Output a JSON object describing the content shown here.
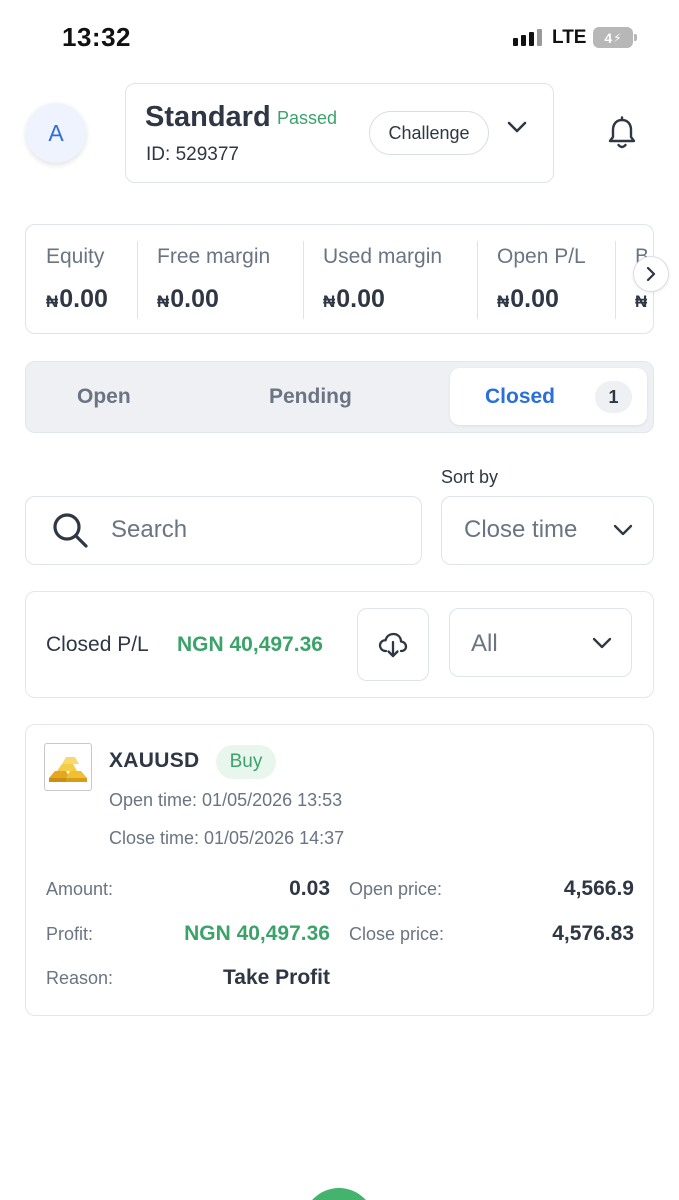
{
  "status_bar": {
    "time": "13:32",
    "network": "LTE",
    "battery": "4"
  },
  "header": {
    "avatar_letter": "A",
    "account_type": "Standard",
    "account_status": "Passed",
    "account_id_label": "ID:",
    "account_id": "529377",
    "challenge_label": "Challenge"
  },
  "metrics": [
    {
      "label": "Equity",
      "currency": "₦",
      "value": "0.00"
    },
    {
      "label": "Free margin",
      "currency": "₦",
      "value": "0.00"
    },
    {
      "label": "Used margin",
      "currency": "₦",
      "value": "0.00"
    },
    {
      "label": "Open P/L",
      "currency": "₦",
      "value": "0.00"
    },
    {
      "label": "B",
      "currency": "₦",
      "value": ""
    }
  ],
  "tabs": {
    "open": "Open",
    "pending": "Pending",
    "closed": "Closed",
    "closed_count": "1"
  },
  "search": {
    "placeholder": "Search"
  },
  "sort": {
    "label": "Sort by",
    "value": "Close time"
  },
  "summary": {
    "closed_pl_label": "Closed P/L",
    "closed_pl_value": "NGN 40,497.36",
    "filter_value": "All"
  },
  "trade": {
    "symbol": "XAUUSD",
    "side": "Buy",
    "open_time": "Open time: 01/05/2026 13:53",
    "close_time": "Close time: 01/05/2026 14:37",
    "amount_label": "Amount:",
    "amount": "0.03",
    "open_price_label": "Open price:",
    "open_price": "4,566.9",
    "profit_label": "Profit:",
    "profit": "NGN 40,497.36",
    "close_price_label": "Close price:",
    "close_price": "4,576.83",
    "reason_label": "Reason:",
    "reason": "Take Profit"
  },
  "colors": {
    "accent": "#2b6fd8",
    "positive": "#3ba36a",
    "text": "#2f3744",
    "muted": "#6b7482"
  },
  "icons": [
    "bell-icon",
    "chevron-down-icon",
    "chevron-right-icon",
    "search-icon",
    "cloud-download-icon",
    "gold-bars-icon"
  ]
}
